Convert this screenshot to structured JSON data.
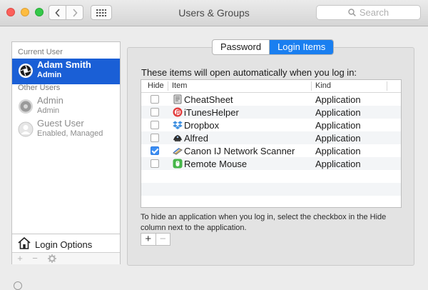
{
  "window": {
    "title": "Users & Groups"
  },
  "search": {
    "placeholder": "Search"
  },
  "sidebar": {
    "current_user_header": "Current User",
    "current_user": {
      "name": "Adam Smith",
      "role": "Admin"
    },
    "other_users_header": "Other Users",
    "other_users": [
      {
        "name": "Admin",
        "role": "Admin"
      },
      {
        "name": "Guest User",
        "role": "Enabled, Managed"
      }
    ],
    "login_options_label": "Login Options",
    "tools": {
      "add": "+",
      "remove": "−"
    }
  },
  "tabs": {
    "password": "Password",
    "login_items": "Login Items",
    "active": "Login Items"
  },
  "main": {
    "intro": "These items will open automatically when you log in:",
    "columns": {
      "hide": "Hide",
      "item": "Item",
      "kind": "Kind"
    },
    "items": [
      {
        "name": "CheatSheet",
        "kind": "Application",
        "hide": false,
        "icon": "cheatsheet-icon"
      },
      {
        "name": "iTunesHelper",
        "kind": "Application",
        "hide": false,
        "icon": "itunes-helper-icon"
      },
      {
        "name": "Dropbox",
        "kind": "Application",
        "hide": false,
        "icon": "dropbox-icon"
      },
      {
        "name": "Alfred",
        "kind": "Application",
        "hide": false,
        "icon": "alfred-icon"
      },
      {
        "name": "Canon IJ Network Scanner",
        "kind": "Application",
        "hide": true,
        "icon": "canon-scanner-icon"
      },
      {
        "name": "Remote Mouse",
        "kind": "Application",
        "hide": false,
        "icon": "remote-mouse-icon"
      }
    ],
    "hint": "To hide an application when you log in, select the checkbox in the Hide column next to the application.",
    "add_label": "+",
    "remove_label": "−"
  },
  "colors": {
    "selection": "#1a5fd6",
    "segment_active": "#1a7ff0",
    "checkbox_checked": "#3b8ef4"
  }
}
